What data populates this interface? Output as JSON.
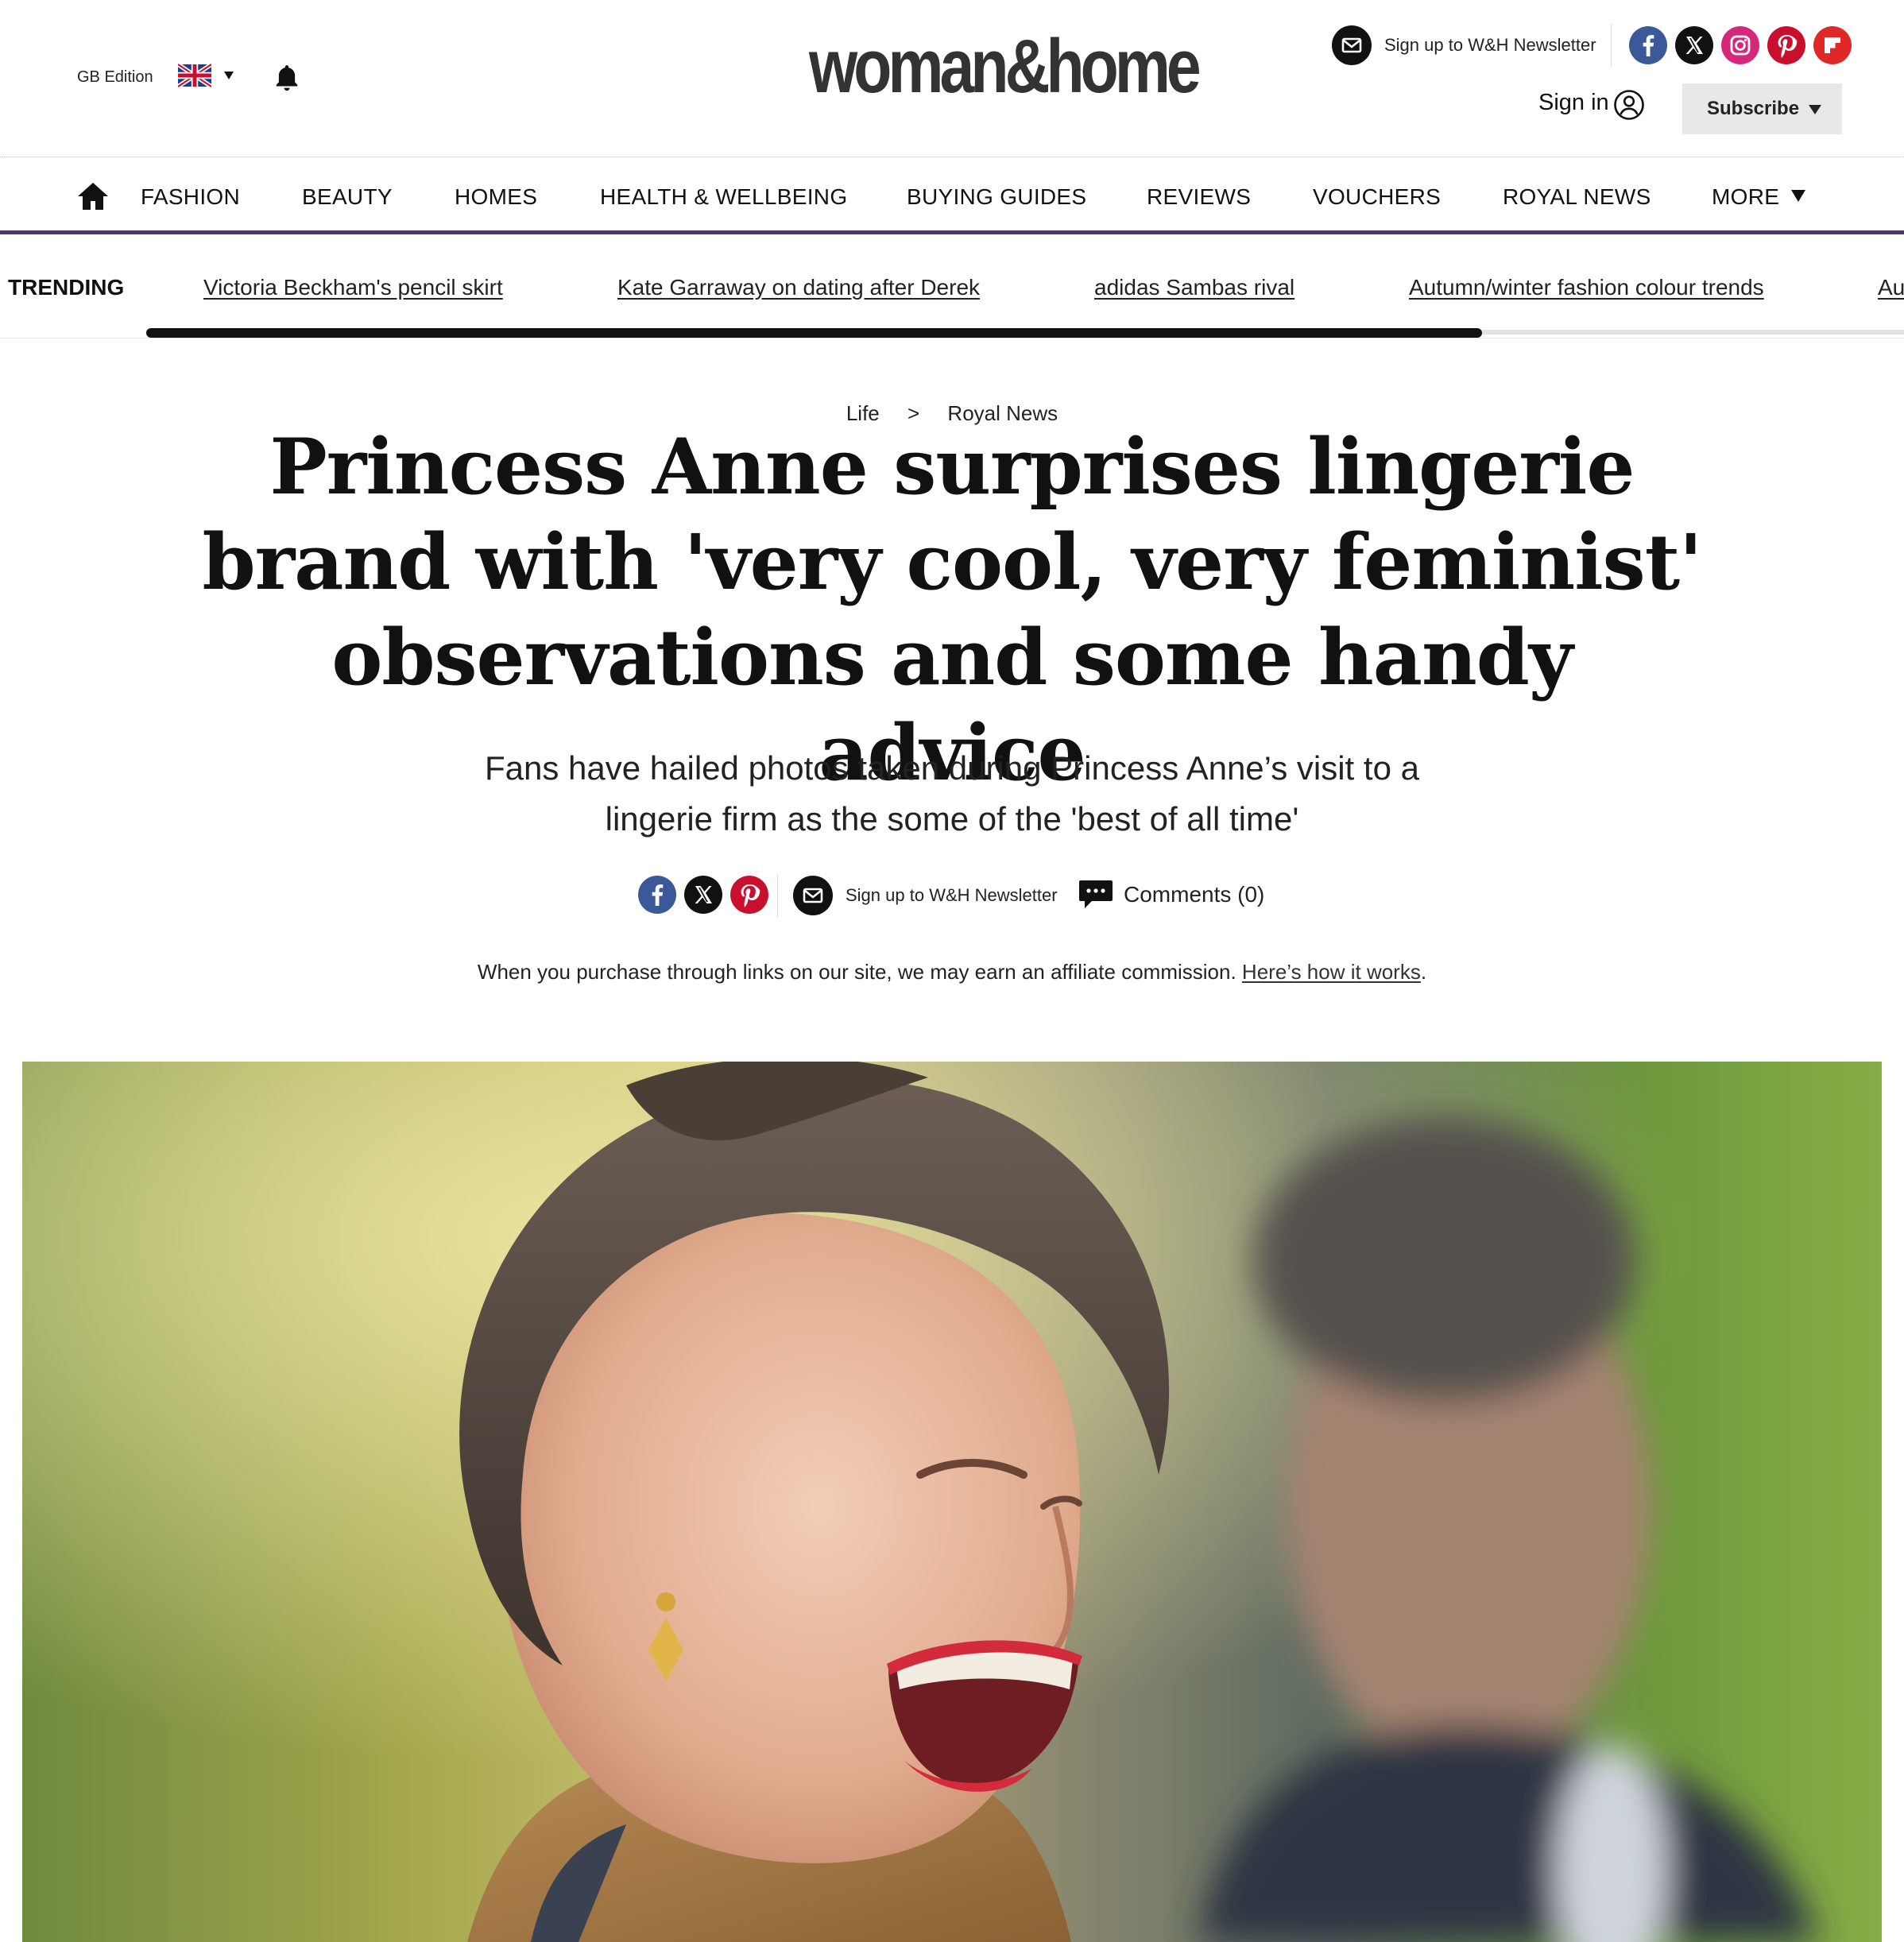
{
  "header": {
    "edition_label": "GB Edition",
    "logo_text": "woman&home",
    "newsletter_label": "Sign up to W&H Newsletter",
    "signin_label": "Sign in",
    "subscribe_label": "Subscribe",
    "social_icons": [
      "facebook-icon",
      "x-icon",
      "instagram-icon",
      "pinterest-icon",
      "flipboard-icon"
    ]
  },
  "nav": {
    "items": [
      "FASHION",
      "BEAUTY",
      "HOMES",
      "HEALTH & WELLBEING",
      "BUYING GUIDES",
      "REVIEWS",
      "VOUCHERS",
      "ROYAL NEWS",
      "MORE"
    ]
  },
  "trending": {
    "label": "TRENDING",
    "links": [
      "Victoria Beckham's pencil skirt",
      "Kate Garraway on dating after Derek",
      "adidas Sambas rival",
      "Autumn/winter fashion colour trends",
      "Au"
    ],
    "scroll_fraction": 0.76
  },
  "article": {
    "breadcrumb": [
      "Life",
      ">",
      "Royal News"
    ],
    "headline": "Princess Anne surprises lingerie brand with 'very cool, very feminist' observations and some handy advice",
    "standfirst": "Fans have hailed photos taken during Princess Anne’s visit to a lingerie firm as the some of the 'best of all time'",
    "share": {
      "icons": [
        "facebook-icon",
        "x-icon",
        "pinterest-icon"
      ],
      "newsletter_label": "Sign up to W&H Newsletter",
      "comments_label": "Comments (0)"
    },
    "affiliate_text": "When you purchase through links on our site, we may earn an affiliate commission.",
    "affiliate_link": "Here’s how it works",
    "affiliate_end": "."
  },
  "colors": {
    "nav_border": "#4b3a5d",
    "facebook": "#3b5998",
    "x": "#111111",
    "instagram": "#d6287b",
    "pinterest": "#c8102e",
    "flipboard": "#e12828",
    "subscribe_bg": "#e8e8e8"
  }
}
